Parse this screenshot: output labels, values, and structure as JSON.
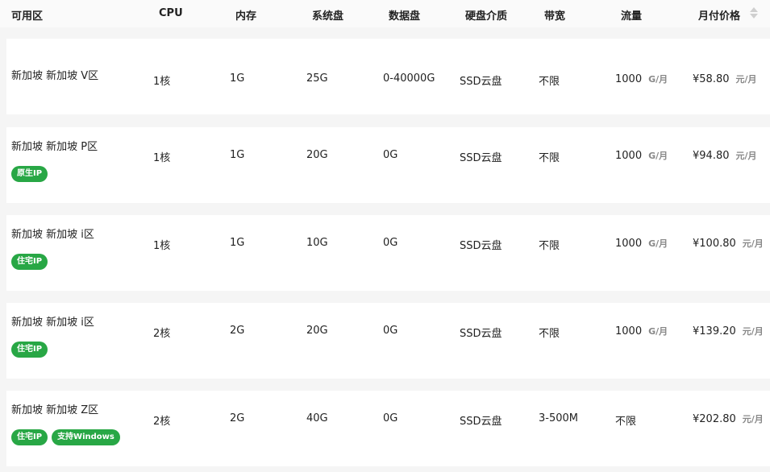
{
  "columns": {
    "zone": "可用区",
    "cpu": "CPU",
    "memory": "内存",
    "system_disk": "系统盘",
    "data_disk": "数据盘",
    "disk_type": "硬盘介质",
    "bandwidth": "带宽",
    "traffic": "流量",
    "monthly_price": "月付价格"
  },
  "rows": [
    {
      "zone": "新加坡 新加坡 V区",
      "badges": [],
      "cpu": "1核",
      "memory": "1G",
      "system_disk": "25G",
      "data_disk": "0-40000G",
      "disk_type": "SSD云盘",
      "bandwidth": "不限",
      "traffic": "1000",
      "traffic_unit": "G/月",
      "price": "¥58.80",
      "price_unit": "元/月"
    },
    {
      "zone": "新加坡 新加坡 P区",
      "badges": [
        "原生IP"
      ],
      "cpu": "1核",
      "memory": "1G",
      "system_disk": "20G",
      "data_disk": "0G",
      "disk_type": "SSD云盘",
      "bandwidth": "不限",
      "traffic": "1000",
      "traffic_unit": "G/月",
      "price": "¥94.80",
      "price_unit": "元/月"
    },
    {
      "zone": "新加坡 新加坡 i区",
      "badges": [
        "住宅IP"
      ],
      "cpu": "1核",
      "memory": "1G",
      "system_disk": "10G",
      "data_disk": "0G",
      "disk_type": "SSD云盘",
      "bandwidth": "不限",
      "traffic": "1000",
      "traffic_unit": "G/月",
      "price": "¥100.80",
      "price_unit": "元/月"
    },
    {
      "zone": "新加坡 新加坡 i区",
      "badges": [
        "住宅IP"
      ],
      "cpu": "2核",
      "memory": "2G",
      "system_disk": "20G",
      "data_disk": "0G",
      "disk_type": "SSD云盘",
      "bandwidth": "不限",
      "traffic": "1000",
      "traffic_unit": "G/月",
      "price": "¥139.20",
      "price_unit": "元/月"
    },
    {
      "zone": "新加坡 新加坡 Z区",
      "badges": [
        "住宅IP",
        "支持Windows"
      ],
      "cpu": "2核",
      "memory": "2G",
      "system_disk": "40G",
      "data_disk": "0G",
      "disk_type": "SSD云盘",
      "bandwidth": "3-500M",
      "traffic": "不限",
      "traffic_unit": "",
      "price": "¥202.80",
      "price_unit": "元/月"
    }
  ],
  "colors": {
    "badge": "#28a745",
    "row_bg": "#ffffff",
    "page_bg": "#f5f5f5"
  },
  "icons": {
    "sort": "sort-icon"
  }
}
